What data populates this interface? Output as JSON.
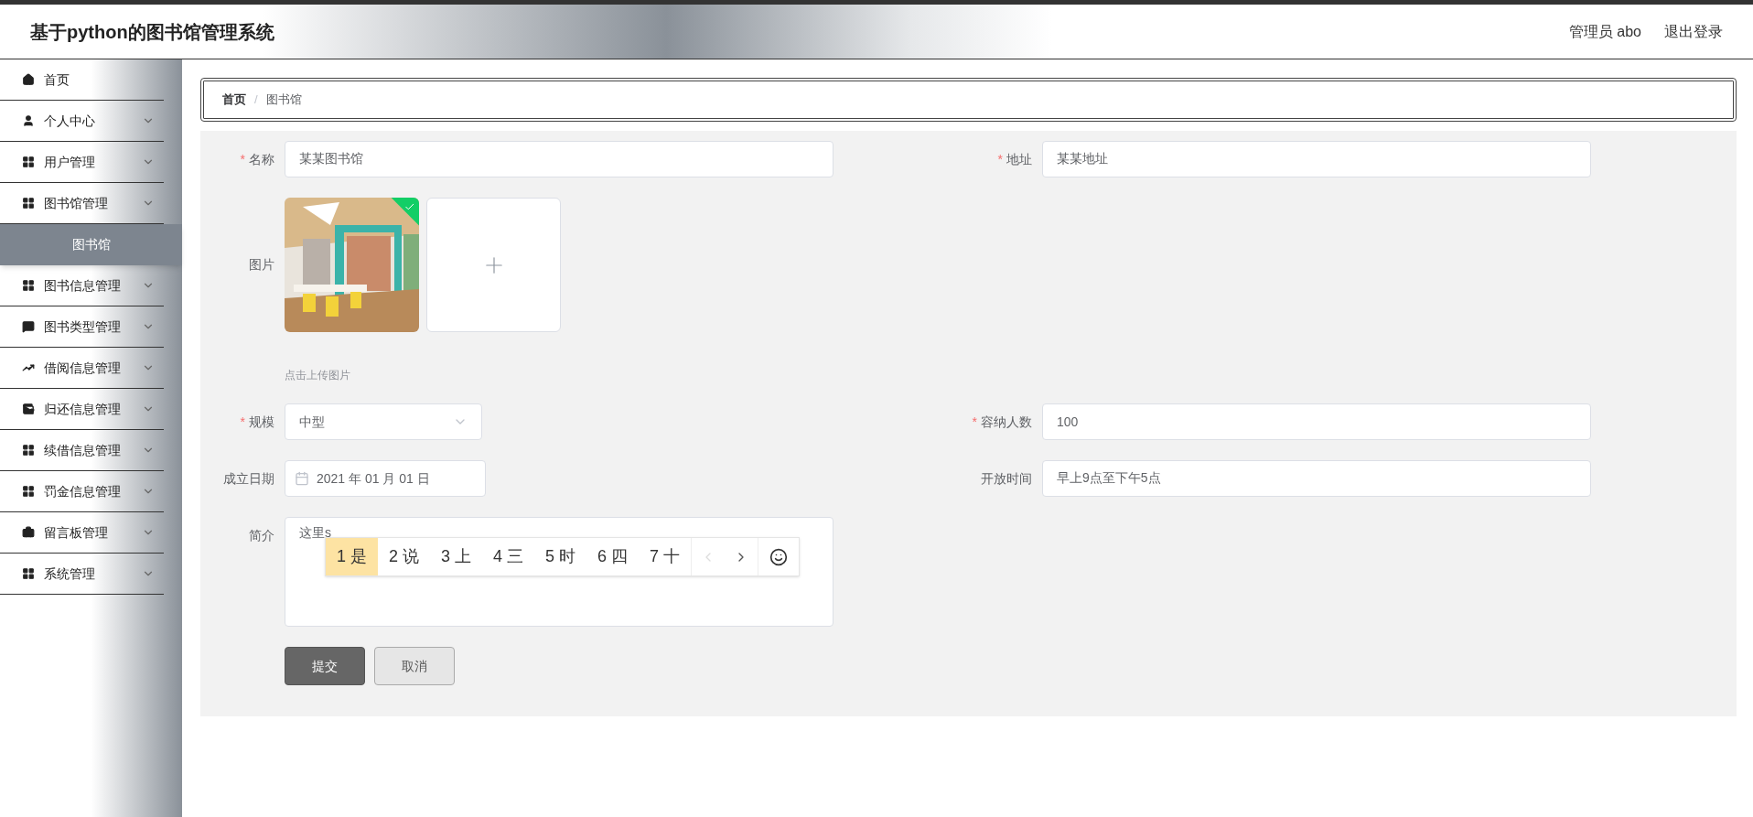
{
  "header": {
    "title": "基于python的图书馆管理系统",
    "user": "管理员 abo",
    "logout": "退出登录"
  },
  "sidebar": {
    "items": [
      {
        "label": "首页",
        "has_arrow": false
      },
      {
        "label": "个人中心",
        "has_arrow": true
      },
      {
        "label": "用户管理",
        "has_arrow": true
      },
      {
        "label": "图书馆管理",
        "has_arrow": true,
        "children": [
          {
            "label": "图书馆",
            "selected": true
          }
        ]
      },
      {
        "label": "图书信息管理",
        "has_arrow": true
      },
      {
        "label": "图书类型管理",
        "has_arrow": true
      },
      {
        "label": "借阅信息管理",
        "has_arrow": true
      },
      {
        "label": "归还信息管理",
        "has_arrow": true
      },
      {
        "label": "续借信息管理",
        "has_arrow": true
      },
      {
        "label": "罚金信息管理",
        "has_arrow": true
      },
      {
        "label": "留言板管理",
        "has_arrow": true
      },
      {
        "label": "系统管理",
        "has_arrow": true
      }
    ]
  },
  "breadcrumb": {
    "separator": "/",
    "items": [
      {
        "label": "首页",
        "current": false
      },
      {
        "label": "图书馆",
        "current": true
      }
    ]
  },
  "form": {
    "required_mark": "*",
    "rows": [
      [
        {
          "kind": "text",
          "label": "名称",
          "required": true,
          "value": "某某图书馆"
        },
        {
          "kind": "text",
          "label": "地址",
          "required": true,
          "value": "某某地址"
        }
      ],
      [
        {
          "kind": "upload",
          "label": "图片",
          "required": false,
          "hint": "点击上传图片",
          "uploaded": true
        }
      ],
      [
        {
          "kind": "select",
          "label": "规模",
          "required": true,
          "value": "中型"
        },
        {
          "kind": "text",
          "label": "容纳人数",
          "required": true,
          "value": "100"
        }
      ],
      [
        {
          "kind": "date",
          "label": "成立日期",
          "required": false,
          "value": "2021 年 01 月 01 日"
        },
        {
          "kind": "text",
          "label": "开放时间",
          "required": false,
          "value": "早上9点至下午5点"
        }
      ],
      [
        {
          "kind": "textarea",
          "label": "简介",
          "required": false,
          "value": "这里s"
        }
      ]
    ],
    "buttons": [
      {
        "label": "提交",
        "kind": "primary"
      },
      {
        "label": "取消",
        "kind": "secondary"
      }
    ]
  },
  "ime": {
    "candidates": [
      {
        "label": "1 是",
        "selected": true
      },
      {
        "label": "2 说",
        "selected": false
      },
      {
        "label": "3 上",
        "selected": false
      },
      {
        "label": "4 三",
        "selected": false
      },
      {
        "label": "5 时",
        "selected": false
      },
      {
        "label": "6 四",
        "selected": false
      },
      {
        "label": "7 十",
        "selected": false
      }
    ],
    "prev_disabled": true
  }
}
